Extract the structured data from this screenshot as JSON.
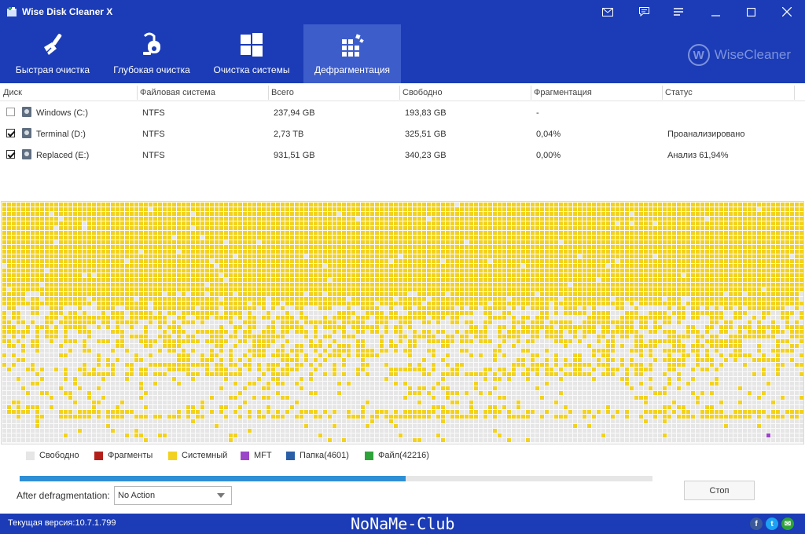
{
  "window": {
    "title": "Wise Disk Cleaner X"
  },
  "tabs": [
    {
      "label": "Быстрая очистка",
      "icon": "broom-icon"
    },
    {
      "label": "Глубокая очистка",
      "icon": "vacuum-icon"
    },
    {
      "label": "Очистка системы",
      "icon": "windows-icon"
    },
    {
      "label": "Дефрагментация",
      "icon": "defrag-icon",
      "active": true
    }
  ],
  "brand": {
    "logo_letter": "W",
    "name": "WiseCleaner"
  },
  "table": {
    "headers": [
      "Диск",
      "Файловая система",
      "Всего",
      "Свободно",
      "Фрагментация",
      "Статус"
    ],
    "rows": [
      {
        "checked": false,
        "name": "Windows (C:)",
        "fs": "NTFS",
        "total": "237,94 GB",
        "free": "193,83 GB",
        "frag": "-",
        "status": ""
      },
      {
        "checked": true,
        "name": "Terminal (D:)",
        "fs": "NTFS",
        "total": "2,73 TB",
        "free": "325,51 GB",
        "frag": "0,04%",
        "status": "Проанализировано"
      },
      {
        "checked": true,
        "name": "Replaced (E:)",
        "fs": "NTFS",
        "total": "931,51 GB",
        "free": "340,23 GB",
        "frag": "0,00%",
        "status": "Анализ 61,94%"
      }
    ]
  },
  "legend": [
    {
      "label": "Свободно",
      "color": "#e6e6e6"
    },
    {
      "label": "Фрагменты",
      "color": "#b3201c"
    },
    {
      "label": "Системный",
      "color": "#f2d21e"
    },
    {
      "label": "MFT",
      "color": "#9b45c9"
    },
    {
      "label": "Папка(4601)",
      "color": "#2a5fa8"
    },
    {
      "label": "Файл(42216)",
      "color": "#2fa33a"
    }
  ],
  "progress": {
    "fraction": 0.61
  },
  "after_defrag": {
    "label": "After defragmentation:",
    "value": "No Action"
  },
  "buttons": {
    "stop": "Стоп"
  },
  "status": {
    "version": "Текущая версия:10.7.1.799",
    "watermark": "NoNaMe-Club"
  },
  "social": [
    {
      "icon": "facebook-icon",
      "glyph": "f",
      "color": "#3b5998"
    },
    {
      "icon": "twitter-icon",
      "glyph": "t",
      "color": "#1da1f2"
    },
    {
      "icon": "mail-icon",
      "glyph": "✉",
      "color": "#2fa33a"
    }
  ],
  "colors": {
    "header": "#1b3cb6",
    "tab_active": "#3d5dcb",
    "system": "#f2d21e",
    "free": "#e6e6e6",
    "progress": "#2e8fd5"
  }
}
